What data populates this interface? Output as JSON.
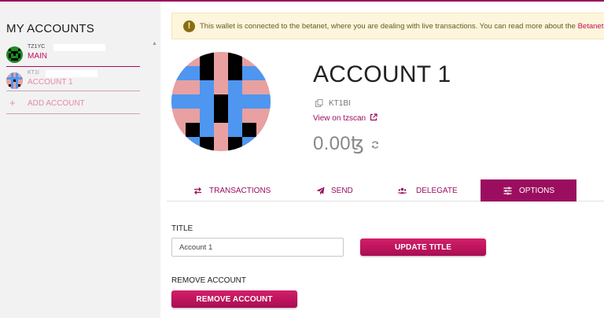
{
  "sidebar": {
    "title": "MY ACCOUNTS",
    "accounts": [
      {
        "address": "TZ1YC",
        "name": "MAIN"
      },
      {
        "address": "KT1I",
        "name": "ACCOUNT 1"
      }
    ],
    "add_account_label": "ADD ACCOUNT"
  },
  "banner": {
    "message": "This wallet is connected to the betanet, where you are dealing with live transactions. You can read more about the ",
    "link": "Betanet expe"
  },
  "account": {
    "title": "ACCOUNT 1",
    "address": "KT1BI",
    "tzscan_label": "View on tzscan",
    "balance": "0.00ꜩ"
  },
  "tabs": [
    {
      "label": "TRANSACTIONS",
      "icon": "arrows-exchange-icon"
    },
    {
      "label": "SEND",
      "icon": "paper-plane-icon"
    },
    {
      "label": "DELEGATE",
      "icon": "users-icon"
    },
    {
      "label": "OPTIONS",
      "icon": "sliders-icon",
      "active": true
    }
  ],
  "form": {
    "title_label": "TITLE",
    "title_value": "Account 1",
    "update_button": "UPDATE TITLE",
    "remove_label": "REMOVE ACCOUNT",
    "remove_button": "REMOVE ACCOUNT"
  },
  "colors": {
    "accent": "#9b0e5f",
    "accent_link": "#c40e5b",
    "identicon_pink": "#e8a0a0",
    "identicon_blue": "#4e96f0",
    "identicon_black": "#000000",
    "banner_bg": "#fdf5dc"
  }
}
